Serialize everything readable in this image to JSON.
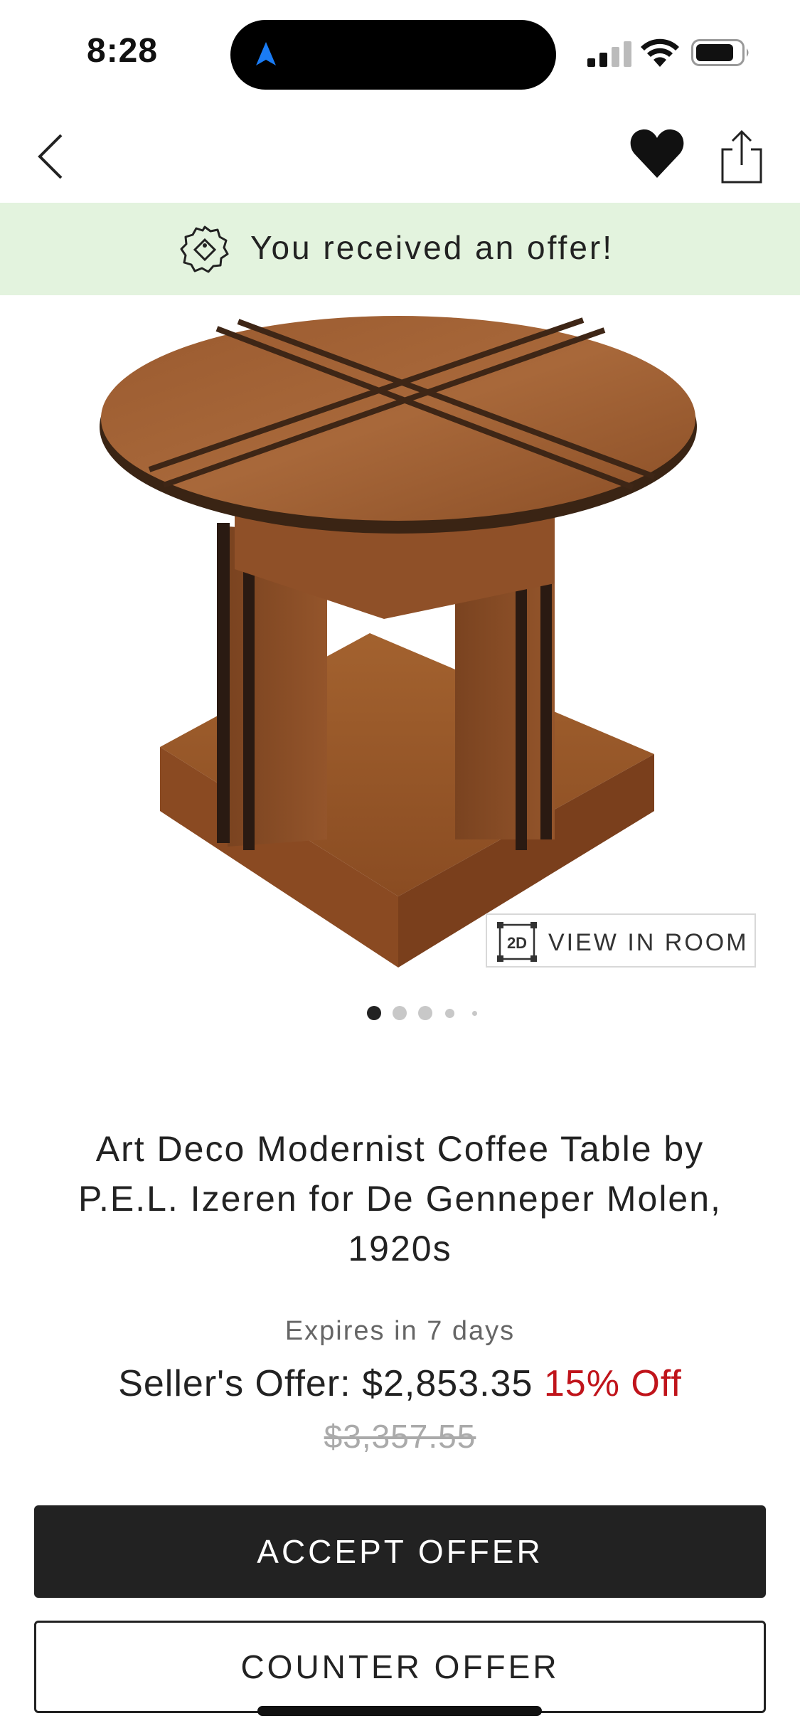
{
  "status_bar": {
    "time": "8:28",
    "icons": [
      "location-arrow-icon",
      "cellular-signal-icon",
      "wifi-icon",
      "battery-icon"
    ]
  },
  "nav": {
    "icons": [
      "back-chevron-icon",
      "heart-icon",
      "share-icon"
    ]
  },
  "banner": {
    "text": "You received an offer!",
    "icon": "price-tag-icon",
    "background": "#e3f3de"
  },
  "gallery": {
    "view_in_room_badge": "2D",
    "view_in_room_label": "VIEW IN ROOM",
    "dot_count": 5,
    "active_dot": 0
  },
  "product": {
    "title": "Art Deco Modernist Coffee Table by P.E.L. Izeren for De Genneper Molen, 1920s",
    "expires": "Expires in 7 days",
    "offer_label": "Seller's Offer:",
    "offer_price": "$2,853.35",
    "discount": "15% Off",
    "original_price": "$3,357.55"
  },
  "actions": {
    "accept_label": "ACCEPT OFFER",
    "counter_label": "COUNTER OFFER"
  },
  "colors": {
    "accent_red": "#c0141b",
    "primary_button": "#222222",
    "banner_green": "#e3f3de",
    "location_blue": "#1a7cf5"
  }
}
